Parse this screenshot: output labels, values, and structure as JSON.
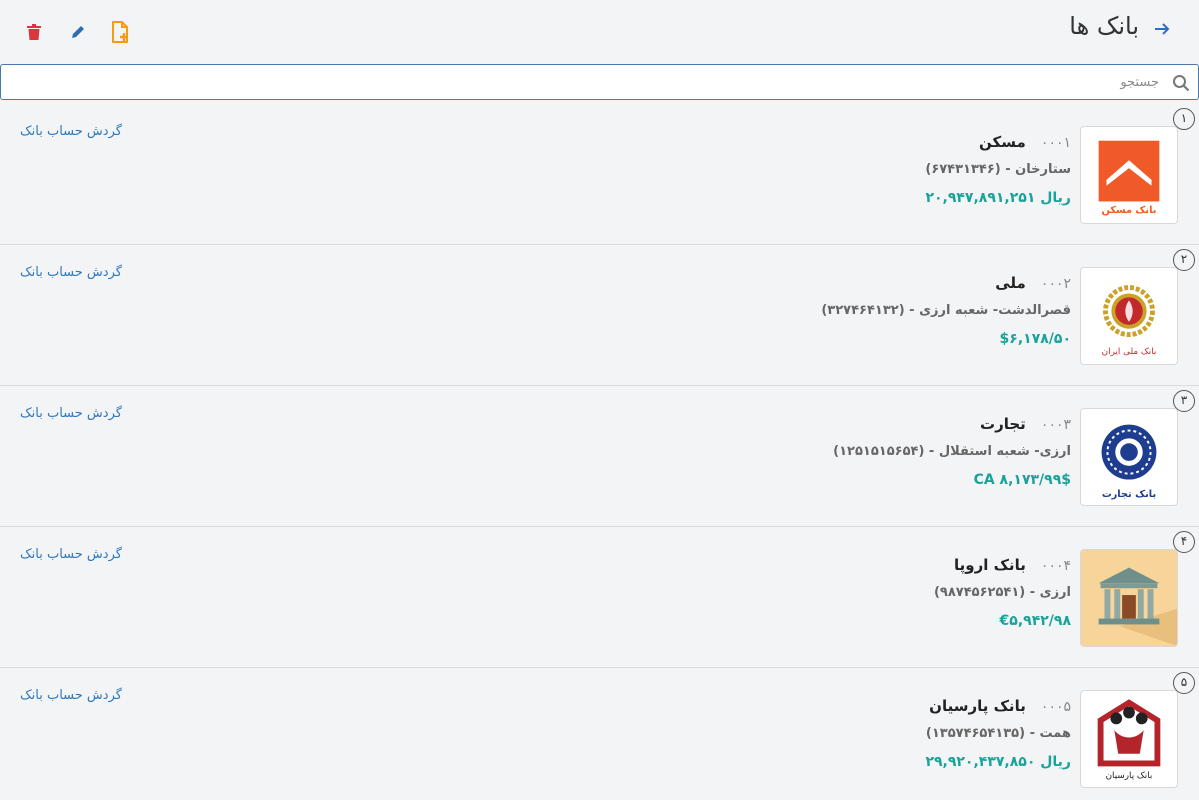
{
  "header": {
    "title": "بانک ها",
    "back_icon": "arrow-right-icon",
    "actions": [
      {
        "name": "add-file-icon",
        "color": "#f39c12"
      },
      {
        "name": "edit-icon",
        "color": "#2c6fb0"
      },
      {
        "name": "delete-icon",
        "color": "#d9363e"
      }
    ]
  },
  "search": {
    "placeholder": "جستجو",
    "value": ""
  },
  "banks": [
    {
      "index": "۱",
      "code": "۰۰۰۱",
      "name": "مسکن",
      "branch": "ستارخان - (۶۷۴۳۱۳۴۶)",
      "balance": "ریال ۲۰,۹۴۷,۸۹۱,۲۵۱",
      "link": "گردش حساب بانک",
      "logo": "maskan-logo",
      "logo_text": "بانک مسکن"
    },
    {
      "index": "۲",
      "code": "۰۰۰۲",
      "name": "ملی",
      "branch": "قصرالدشت- شعبه ارزی - (۳۲۷۴۶۴۱۳۲)",
      "balance": "$۶,۱۷۸/۵۰",
      "link": "گردش حساب بانک",
      "logo": "melli-logo",
      "logo_text": "بانک ملی ایران"
    },
    {
      "index": "۳",
      "code": "۰۰۰۳",
      "name": "تجارت",
      "branch": "ارزی- شعبه استقلال - (۱۲۵۱۵۱۵۶۵۴)",
      "balance": "$CA ۸,۱۷۳/۹۹",
      "link": "گردش حساب بانک",
      "logo": "tejarat-logo",
      "logo_text": "بانک تجارت"
    },
    {
      "index": "۴",
      "code": "۰۰۰۴",
      "name": "بانک اروپا",
      "branch": "ارزی - (۹۸۷۴۵۶۲۵۴۱)",
      "balance": "€۵,۹۴۲/۹۸",
      "link": "گردش حساب بانک",
      "logo": "bank-building-icon",
      "logo_text": ""
    },
    {
      "index": "۵",
      "code": "۰۰۰۵",
      "name": "بانک پارسیان",
      "branch": "همت - (۱۳۵۷۴۶۵۴۱۳۵)",
      "balance": "ریال ۲۹,۹۲۰,۴۳۷,۸۵۰",
      "link": "گردش حساب بانک",
      "logo": "parsian-logo",
      "logo_text": "بانک پارسیان"
    }
  ],
  "colors": {
    "accent_blue": "#2f78bd",
    "balance_teal": "#19a39a",
    "maskan_orange": "#f05a28",
    "melli_red": "#c3282d",
    "melli_gold": "#c9a227",
    "tejarat_navy": "#1f3d8f",
    "parsian_red": "#b3252b"
  }
}
